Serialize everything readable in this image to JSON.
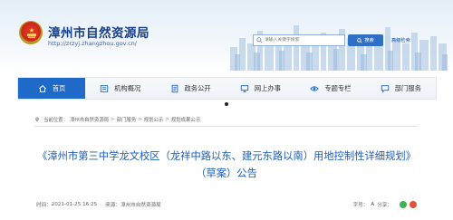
{
  "header": {
    "site_title": "漳州市自然资源局",
    "site_url": "http://zrzyj.zhangzhou.gov.cn/",
    "emblem_icon": "national-emblem-icon",
    "search": {
      "placeholder": "请输入关键字搜索",
      "button_label": "搜索",
      "advanced_label": "高级检索"
    }
  },
  "nav": {
    "items": [
      {
        "label": "首页",
        "icon": "home-icon",
        "active": true
      },
      {
        "label": "机构概况",
        "icon": "org-icon",
        "active": false
      },
      {
        "label": "政务公开",
        "icon": "doc-icon",
        "active": false
      },
      {
        "label": "网上办事",
        "icon": "monitor-icon",
        "active": false
      },
      {
        "label": "专题专栏",
        "icon": "eye-icon",
        "active": false
      },
      {
        "label": "部门服务",
        "icon": "chat-icon",
        "active": false
      }
    ]
  },
  "breadcrumb": {
    "prefix": "当前位置：",
    "items": [
      "漳州市自然资源局",
      "部门服务",
      "规划公示",
      "规划成果公示"
    ]
  },
  "article": {
    "title": "《漳州市第三中学龙文校区（龙祥中路以东、建元东路以南）用地控制性详细规划》（草案）公告",
    "date_label": "时间：",
    "date": "2021-01-25 16:25",
    "source_label": "来源：",
    "source": "漳州市自然资源局",
    "font_size_label": "字号：",
    "font_size_current": "A",
    "share_label": "分享："
  },
  "colors": {
    "brand_blue": "#1f6ac9",
    "title_blue": "#1d5db5",
    "header_text": "#173f8a"
  }
}
